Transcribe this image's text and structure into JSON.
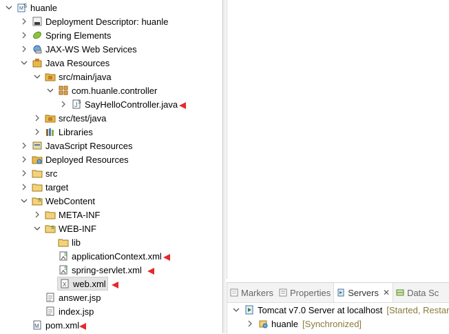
{
  "tree": {
    "project": "huanle",
    "items": [
      "Deployment Descriptor: huanle",
      "Spring Elements",
      "JAX-WS Web Services",
      "Java Resources",
      "src/main/java",
      "com.huanle.controller",
      "SayHelloController.java",
      "src/test/java",
      "Libraries",
      "JavaScript Resources",
      "Deployed Resources",
      "src",
      "target",
      "WebContent",
      "META-INF",
      "WEB-INF",
      "lib",
      "applicationContext.xml",
      "spring-servlet.xml",
      "web.xml",
      "answer.jsp",
      "index.jsp",
      "pom.xml"
    ]
  },
  "bottom": {
    "tabs": [
      "Markers",
      "Properties",
      "Servers",
      "Data Sc"
    ],
    "server": {
      "name": "Tomcat v7.0 Server at localhost",
      "status": "[Started, Restar"
    },
    "module": {
      "name": "huanle",
      "status": "[Synchronized]"
    }
  },
  "colors": {
    "annotation_arrow": "#e8282b",
    "folder": "#e8b84a",
    "package": "#c77d2a"
  }
}
